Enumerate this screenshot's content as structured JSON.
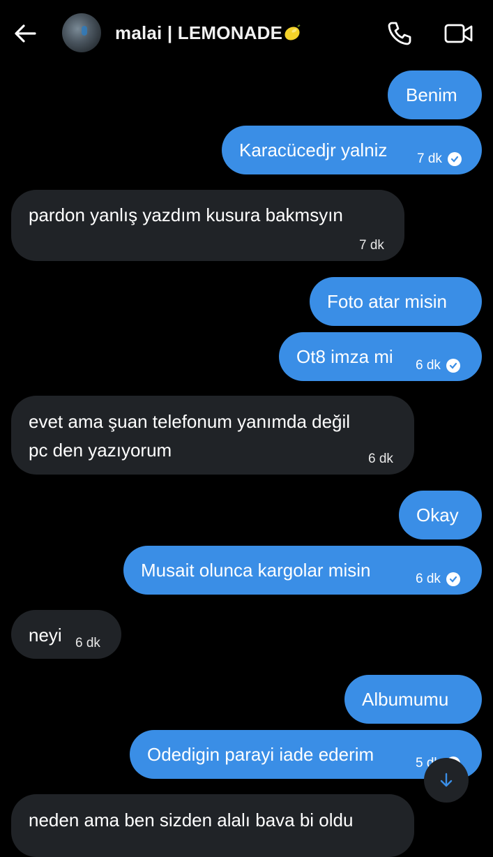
{
  "header": {
    "contact_name": "malai | LEMONADE",
    "icons": {
      "back": "arrow-left-icon",
      "call": "phone-icon",
      "video": "video-camera-icon",
      "emoji": "lemon-icon"
    }
  },
  "colors": {
    "outgoing": "#3a8ee6",
    "incoming": "#202327",
    "background": "#000000"
  },
  "messages": [
    {
      "dir": "out",
      "text": "Benim"
    },
    {
      "dir": "out",
      "text": "Karacücedjr yalniz",
      "time": "7 dk",
      "read": true
    },
    {
      "dir": "in",
      "text": "pardon yanlış yazdım kusura bakmsyın",
      "time": "7 dk"
    },
    {
      "dir": "out",
      "text": "Foto atar misin"
    },
    {
      "dir": "out",
      "text": "Ot8 imza mi",
      "time": "6 dk",
      "read": true
    },
    {
      "dir": "in",
      "text_line1": "evet ama şuan telefonum yanımda değil",
      "text_line2": "pc den yazıyorum",
      "time": "6 dk"
    },
    {
      "dir": "out",
      "text": "Okay"
    },
    {
      "dir": "out",
      "text": "Musait olunca kargolar misin",
      "time": "6 dk",
      "read": true
    },
    {
      "dir": "in",
      "text": "neyi",
      "time": "6 dk"
    },
    {
      "dir": "out",
      "text": "Albumumu"
    },
    {
      "dir": "out",
      "text": "Odedigin parayi iade ederim",
      "time": "5 dk",
      "read": true
    },
    {
      "dir": "in",
      "text": "neden ama ben sizden alalı bava bi oldu"
    }
  ],
  "scroll_button": {
    "icon": "arrow-down-icon"
  }
}
